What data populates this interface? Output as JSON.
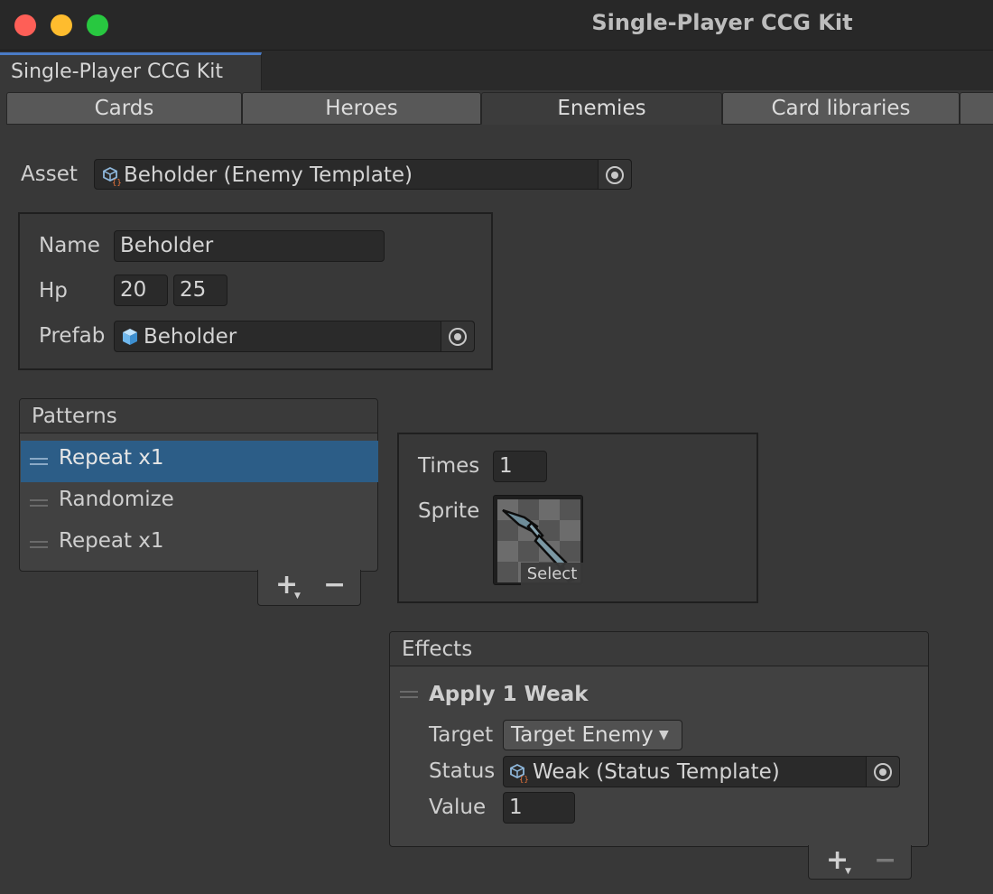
{
  "window": {
    "title": "Single-Player CCG Kit",
    "tab_label": "Single-Player CCG Kit"
  },
  "colors": {
    "close": "#fe5f57",
    "minimize": "#febc2e",
    "zoom": "#28c840",
    "selection": "#2c5d87"
  },
  "tabs": [
    "Cards",
    "Heroes",
    "Enemies",
    "Card libraries"
  ],
  "selected_tab": "Enemies",
  "asset": {
    "label": "Asset",
    "value": "Beholder (Enemy Template)",
    "icon": "scriptable-object-icon"
  },
  "enemy": {
    "name_label": "Name",
    "name_value": "Beholder",
    "hp_label": "Hp",
    "hp_min": "20",
    "hp_max": "25",
    "prefab_label": "Prefab",
    "prefab_value": "Beholder",
    "prefab_icon": "prefab-cube-icon"
  },
  "patterns": {
    "header": "Patterns",
    "items": [
      "Repeat x1",
      "Randomize",
      "Repeat x1"
    ],
    "selected_index": 0,
    "add_label": "+",
    "remove_label": "−"
  },
  "pattern_detail": {
    "times_label": "Times",
    "times_value": "1",
    "sprite_label": "Sprite",
    "sprite_select": "Select"
  },
  "effects": {
    "header": "Effects",
    "item_title": "Apply 1 Weak",
    "target_label": "Target",
    "target_value": "Target Enemy",
    "status_label": "Status",
    "status_value": "Weak (Status Template)",
    "value_label": "Value",
    "value_value": "1",
    "add_label": "+",
    "remove_label": "−"
  }
}
